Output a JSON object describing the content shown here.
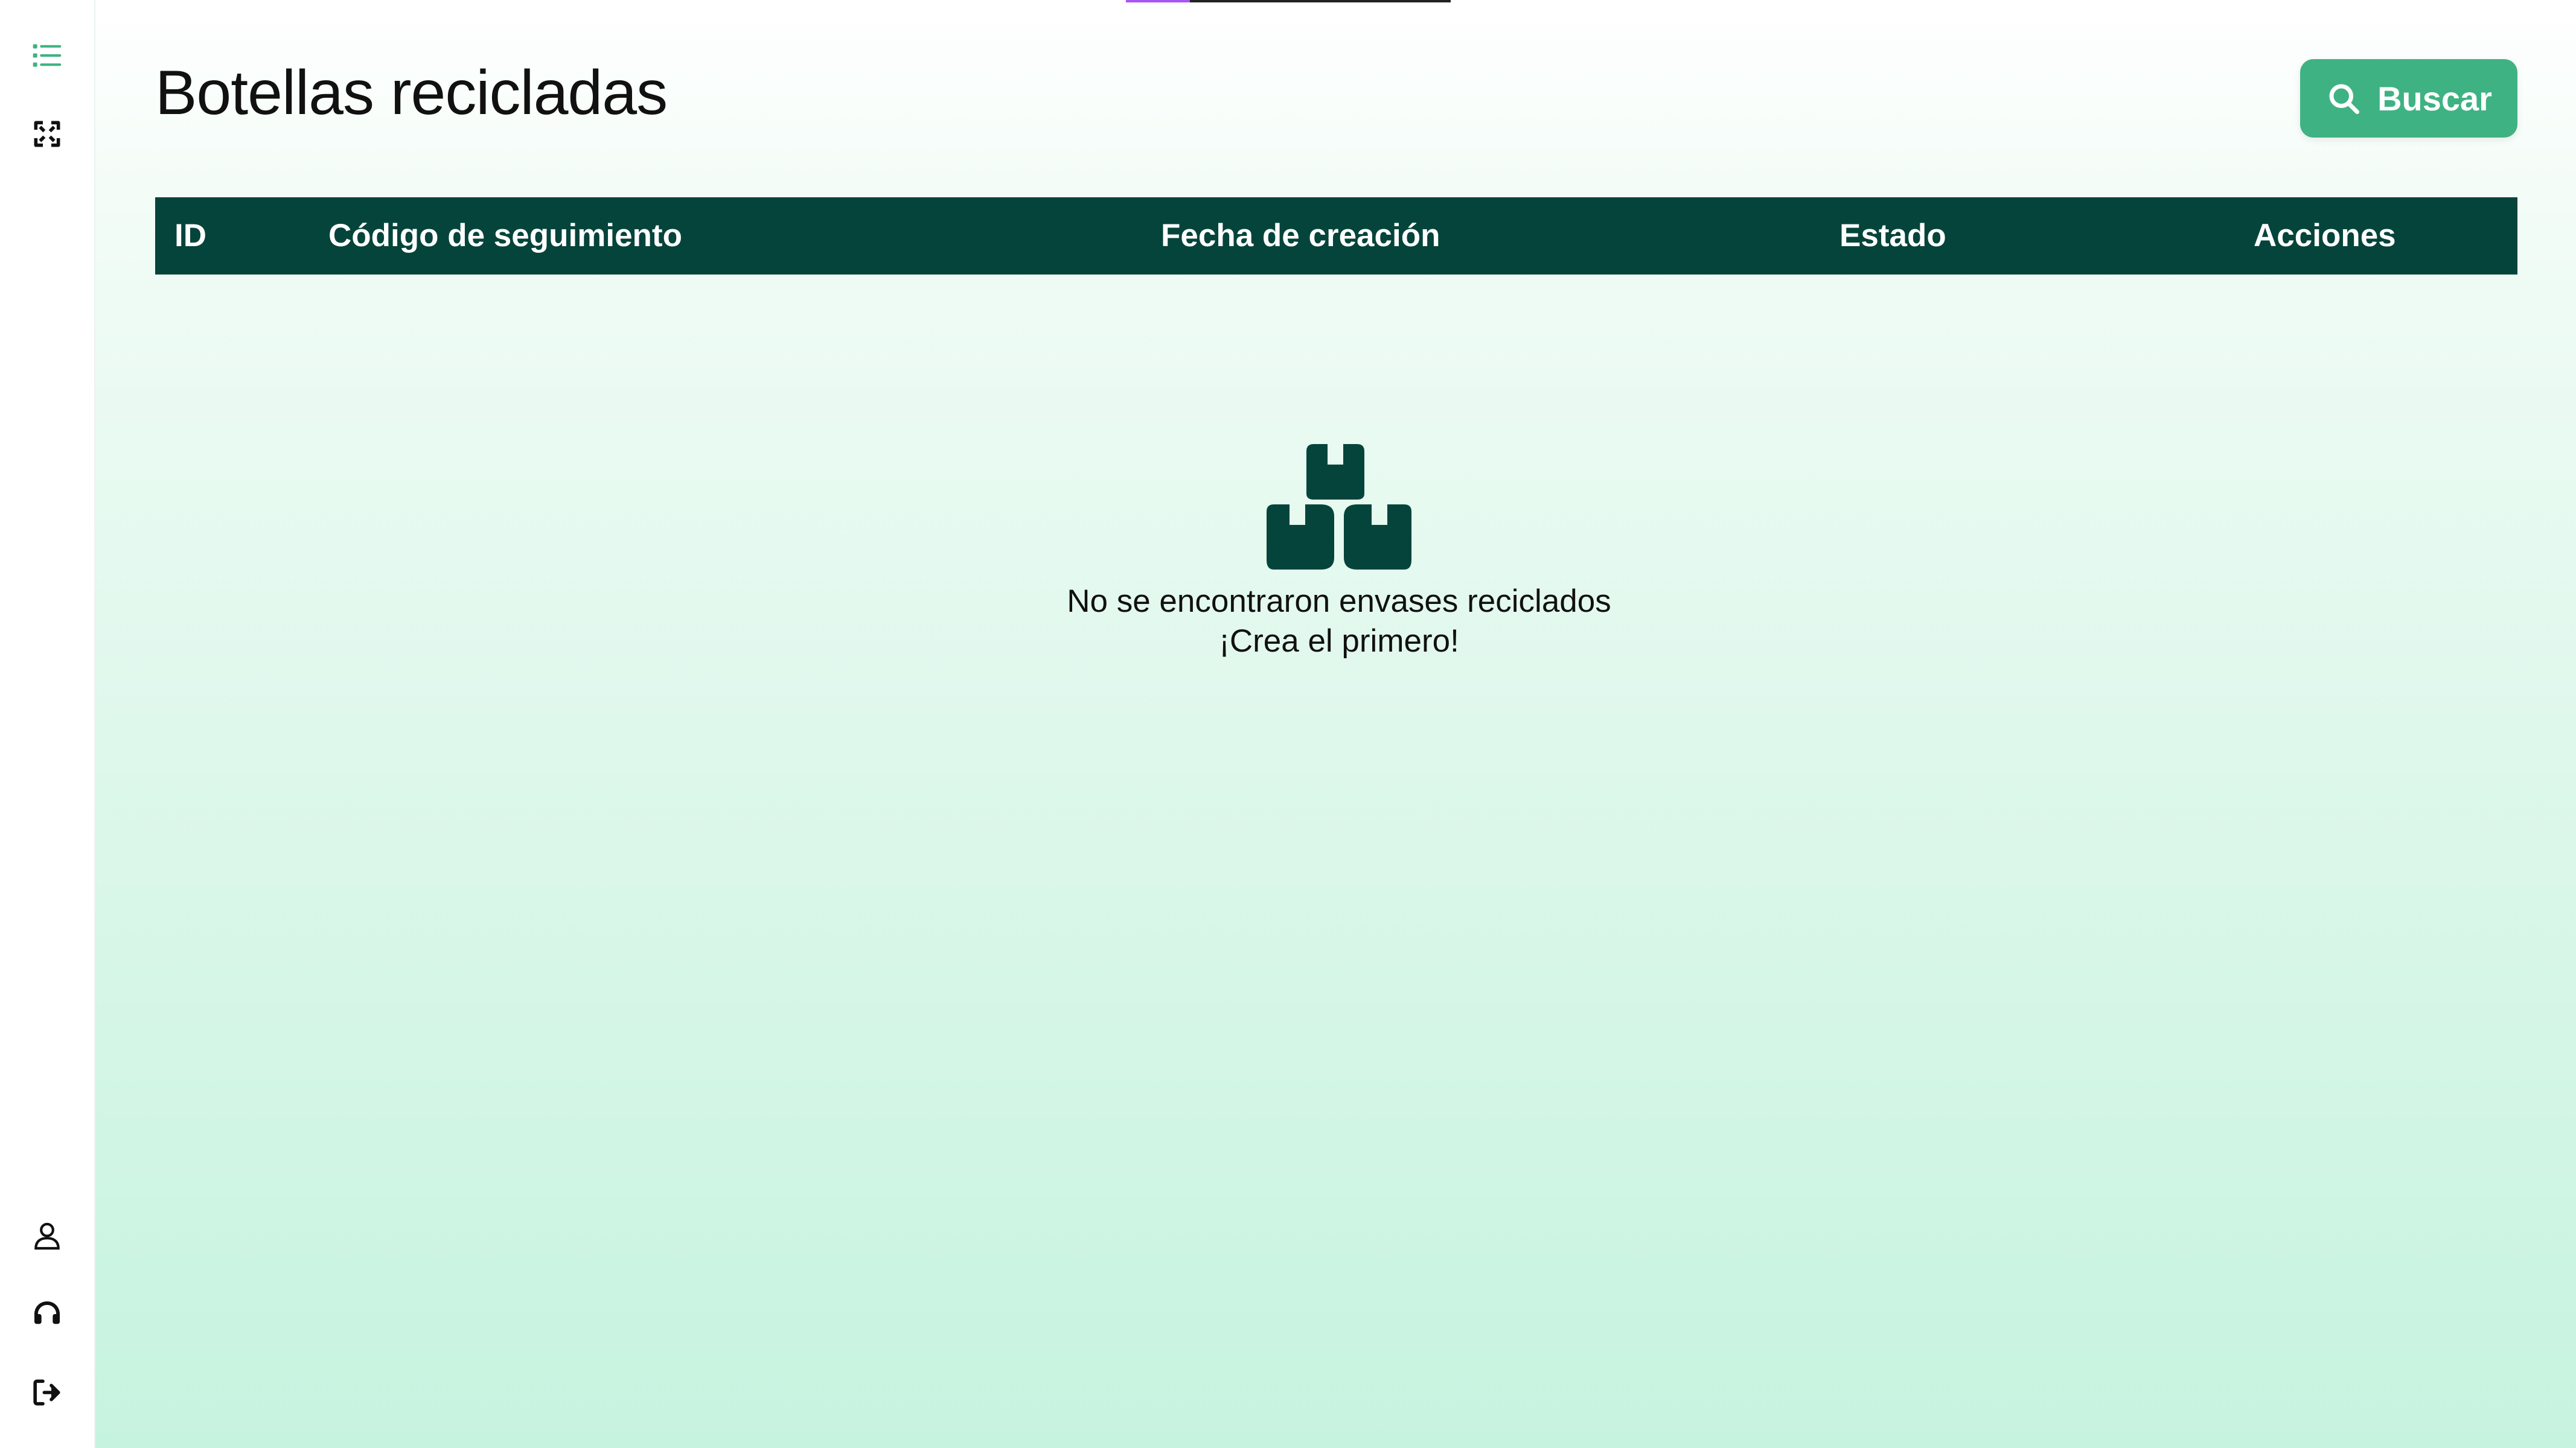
{
  "sidebar": {
    "top_items": [
      {
        "icon": "list-icon",
        "color": "#3fb283"
      },
      {
        "icon": "recycle-icon",
        "color": "#111111"
      }
    ],
    "bottom_items": [
      {
        "icon": "user-icon"
      },
      {
        "icon": "headset-icon"
      },
      {
        "icon": "logout-icon"
      }
    ]
  },
  "header": {
    "title": "Botellas recicladas",
    "search_label": "Buscar",
    "search_icon": "search-icon"
  },
  "table": {
    "columns": [
      "ID",
      "Código de seguimiento",
      "Fecha de creación",
      "Estado",
      "Acciones"
    ],
    "rows": []
  },
  "empty_state": {
    "icon": "boxes-icon",
    "line1": "No se encontraron envases reciclados",
    "line2": "¡Crea el primero!"
  },
  "colors": {
    "accent": "#3fb283",
    "table_header": "#05443b",
    "icon_dark": "#05443b"
  }
}
